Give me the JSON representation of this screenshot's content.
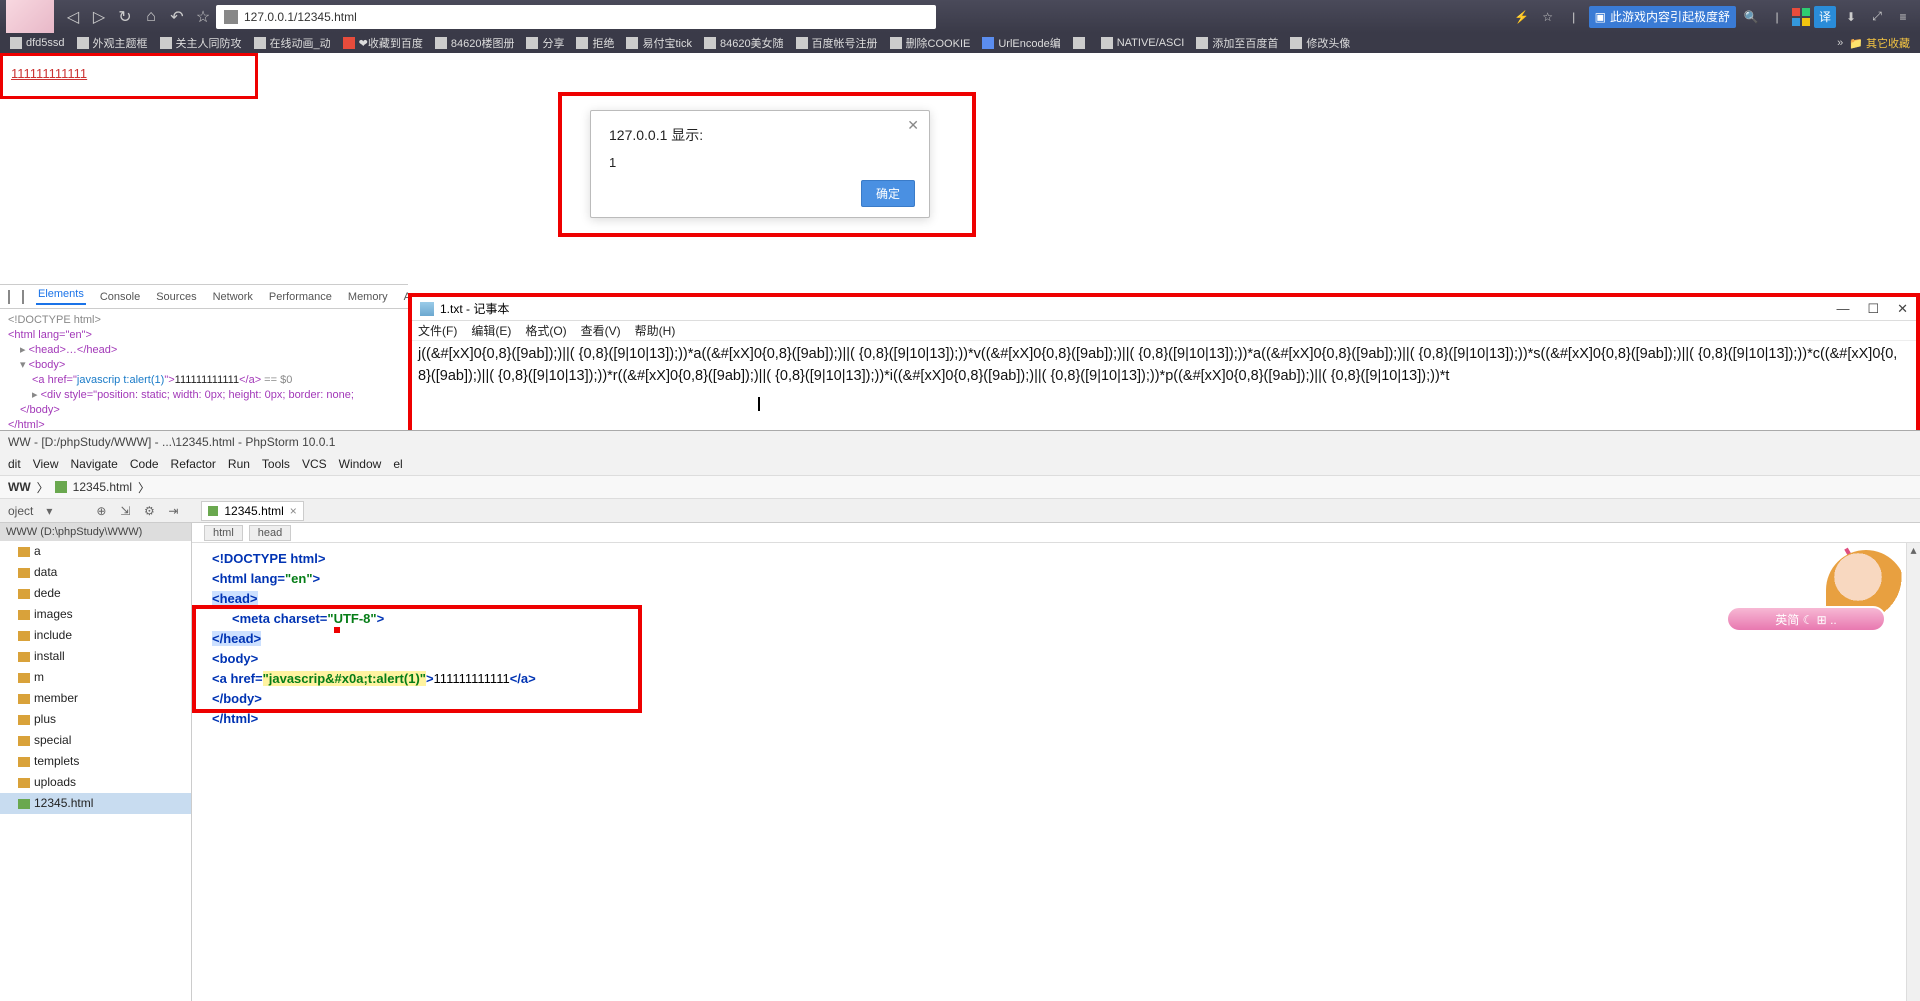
{
  "browser": {
    "url": "127.0.0.1/12345.html",
    "promo": "此游戏内容引起极度舒",
    "bookmarks": [
      "dfd5ssd",
      "外观主题框",
      "关主人同防攻",
      "在线动画_动",
      "❤收藏到百度",
      "84620楼图册",
      "分享",
      "拒绝",
      "易付宝tick",
      "84620美女随",
      "百度帐号注册",
      "删除COOKIE",
      "UrlEncode编",
      "",
      "NATIVE/ASCI",
      "添加至百度首",
      "修改头像"
    ],
    "bm_right": "其它收藏"
  },
  "link_text": "111111111111",
  "alert": {
    "title": "127.0.0.1 显示:",
    "message": "1",
    "ok": "确定"
  },
  "devtools": {
    "tabs": [
      "Elements",
      "Console",
      "Sources",
      "Network",
      "Performance",
      "Memory",
      "A"
    ],
    "dom": {
      "doctype": "<!DOCTYPE html>",
      "html": "<html lang=\"en\">",
      "head": "<head>…</head>",
      "body": "<body>",
      "a_open": "<a href=\"",
      "a_href": "javascrip t:alert(1)",
      "a_mid": "\">",
      "a_text": "111111111111",
      "a_close": "</a>",
      "a_cmt": " == $0",
      "div": "<div style=\"position: static; width: 0px; height: 0px; border: none;",
      "body_close": "</body>",
      "html_close": "</html>"
    }
  },
  "notepad": {
    "title": "1.txt - 记事本",
    "menus": [
      "文件(F)",
      "编辑(E)",
      "格式(O)",
      "查看(V)",
      "帮助(H)"
    ],
    "content": "j((&#[xX]0{0,8}([9ab]);)||( {0,8}([9|10|13]);))*a((&#[xX]0{0,8}([9ab]);)||( {0,8}([9|10|13]);))*v((&#[xX]0{0,8}([9ab]);)||( {0,8}([9|10|13]);))*a((&#[xX]0{0,8}([9ab]);)||( {0,8}([9|10|13]);))*s((&#[xX]0{0,8}([9ab]);)||( {0,8}([9|10|13]);))*c((&#[xX]0{0,8}([9ab]);)||( {0,8}([9|10|13]);))*r((&#[xX]0{0,8}([9ab]);)||( {0,8}([9|10|13]);))*i((&#[xX]0{0,8}([9ab]);)||( {0,8}([9|10|13]);))*p((&#[xX]0{0,8}([9ab]);)||( {0,8}([9|10|13]);))*t"
  },
  "phpstorm": {
    "title": "WW - [D:/phpStudy/WWW] - ...\\12345.html - PhpStorm 10.0.1",
    "menus": [
      "dit",
      "View",
      "Navigate",
      "Code",
      "Refactor",
      "Run",
      "Tools",
      "VCS",
      "Window",
      "el"
    ],
    "crumb_root": "WW",
    "crumb_file": "12345.html",
    "project_label": "oject",
    "filetab": "12345.html",
    "tree_root": "WWW (D:\\phpStudy\\WWW)",
    "tree": [
      "a",
      "data",
      "dede",
      "images",
      "include",
      "install",
      "m",
      "member",
      "plus",
      "special",
      "templets",
      "uploads"
    ],
    "tree_file": "12345.html",
    "pathbar": [
      "html",
      "head"
    ],
    "code": {
      "l1": "<!DOCTYPE ",
      "l1b": "html",
      "l1c": ">",
      "l2": "<html ",
      "l2b": "lang=",
      "l2c": "\"en\"",
      "l2d": ">",
      "l3": "<head>",
      "l4": "<meta ",
      "l4b": "charset=",
      "l4c": "\"UTF-8\"",
      "l4d": ">",
      "l5": "</head>",
      "l6": "<body>",
      "l7": "<a ",
      "l7b": "href=",
      "l7c": "\"javascrip&#x0a;t:alert(1)\"",
      "l7d": ">",
      "l7e": "111111111111",
      "l7f": "</a>",
      "l8": "</body>",
      "l9": "</html>"
    }
  },
  "mascot_label": "英简 ☾ ⊞ .."
}
